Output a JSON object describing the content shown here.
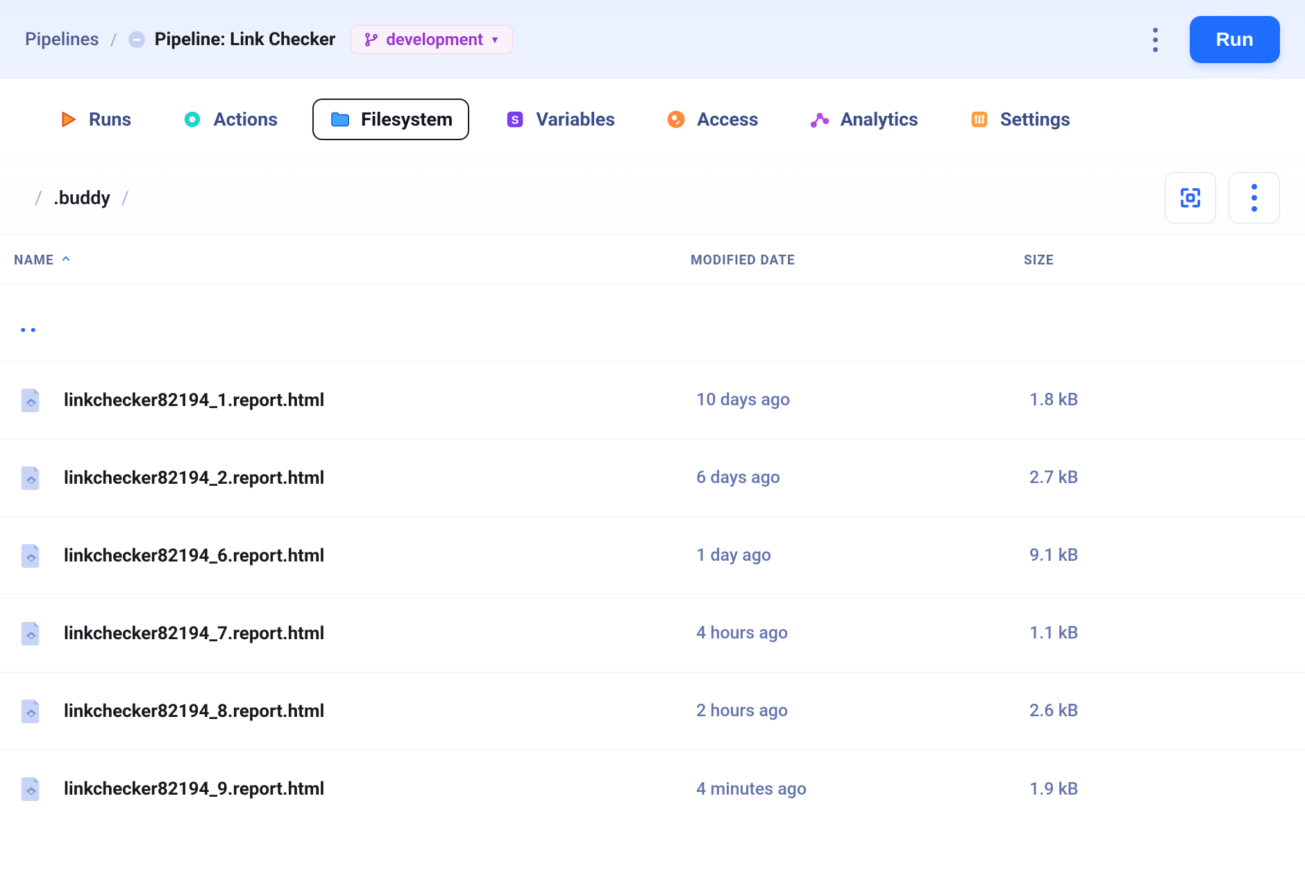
{
  "header": {
    "breadcrumb_root": "Pipelines",
    "pipeline_name": "Pipeline: Link Checker",
    "branch_label": "development",
    "run_label": "Run"
  },
  "tabs": {
    "runs": "Runs",
    "actions": "Actions",
    "filesystem": "Filesystem",
    "variables": "Variables",
    "access": "Access",
    "analytics": "Analytics",
    "settings": "Settings"
  },
  "toolbar": {
    "path_segments": [
      ".buddy"
    ]
  },
  "columns": {
    "name": "NAME",
    "modified": "MODIFIED DATE",
    "size": "SIZE"
  },
  "parent_marker": "..",
  "files": [
    {
      "name": "linkchecker82194_1.report.html",
      "modified": "10 days ago",
      "size": "1.8 kB"
    },
    {
      "name": "linkchecker82194_2.report.html",
      "modified": "6 days ago",
      "size": "2.7 kB"
    },
    {
      "name": "linkchecker82194_6.report.html",
      "modified": "1 day ago",
      "size": "9.1 kB"
    },
    {
      "name": "linkchecker82194_7.report.html",
      "modified": "4 hours ago",
      "size": "1.1 kB"
    },
    {
      "name": "linkchecker82194_8.report.html",
      "modified": "2 hours ago",
      "size": "2.6 kB"
    },
    {
      "name": "linkchecker82194_9.report.html",
      "modified": "4 minutes ago",
      "size": "1.9 kB"
    }
  ]
}
